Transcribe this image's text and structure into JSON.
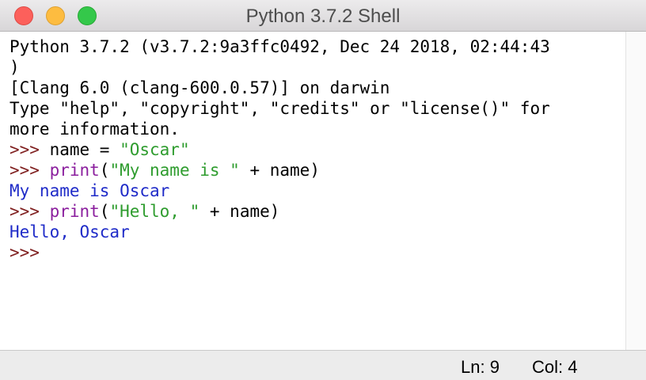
{
  "window": {
    "title": "Python 3.7.2 Shell"
  },
  "shell": {
    "banner_line1": "Python 3.7.2 (v3.7.2:9a3ffc0492, Dec 24 2018, 02:44:43",
    "banner_line2": ")",
    "banner_line3": "[Clang 6.0 (clang-600.0.57)] on darwin",
    "banner_line4": "Type \"help\", \"copyright\", \"credits\" or \"license()\" for",
    "banner_line5": "more information.",
    "prompt": ">>> ",
    "cmd1_pre": "name = ",
    "cmd1_str": "\"Oscar\"",
    "cmd2_kw": "print",
    "cmd2_open": "(",
    "cmd2_str": "\"My name is \"",
    "cmd2_rest": " + name)",
    "out1": "My name is Oscar",
    "cmd3_kw": "print",
    "cmd3_open": "(",
    "cmd3_str": "\"Hello, \"",
    "cmd3_rest": " + name)",
    "out2": "Hello, Oscar",
    "final_prompt": ">>> "
  },
  "status": {
    "line": "Ln: 9",
    "col": "Col: 4"
  },
  "colors": {
    "prompt": "#7f1f1f",
    "keyword": "#8b1f9e",
    "string": "#2e9c2e",
    "output": "#1f2bc8"
  },
  "icons": [
    "close-button",
    "minimize-button",
    "zoom-button"
  ]
}
